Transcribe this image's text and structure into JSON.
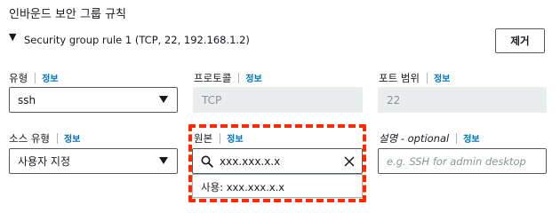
{
  "section": {
    "title": "인바운드 보안 그룹 규칙",
    "rule_title": "Security group rule 1 (TCP, 22, 192.168.1.2)",
    "remove_label": "제거"
  },
  "fields": {
    "type_label": "유형",
    "type_value": "ssh",
    "protocol_label": "프로토콜",
    "protocol_value": "TCP",
    "port_label": "포트 범위",
    "port_value": "22",
    "source_type_label": "소스 유형",
    "source_type_value": "사용자 지정",
    "source_label": "원본",
    "source_value": "xxx.xxx.x.x",
    "description_label": "설명 - optional",
    "description_placeholder": "e.g. SSH for admin desktop",
    "info": "정보"
  },
  "dropdown": {
    "option": "사용: xxx.xxx.x.x"
  },
  "colors": {
    "link": "#0073bb",
    "highlight": "#ff2a00",
    "disabled_bg": "#eaeded"
  }
}
